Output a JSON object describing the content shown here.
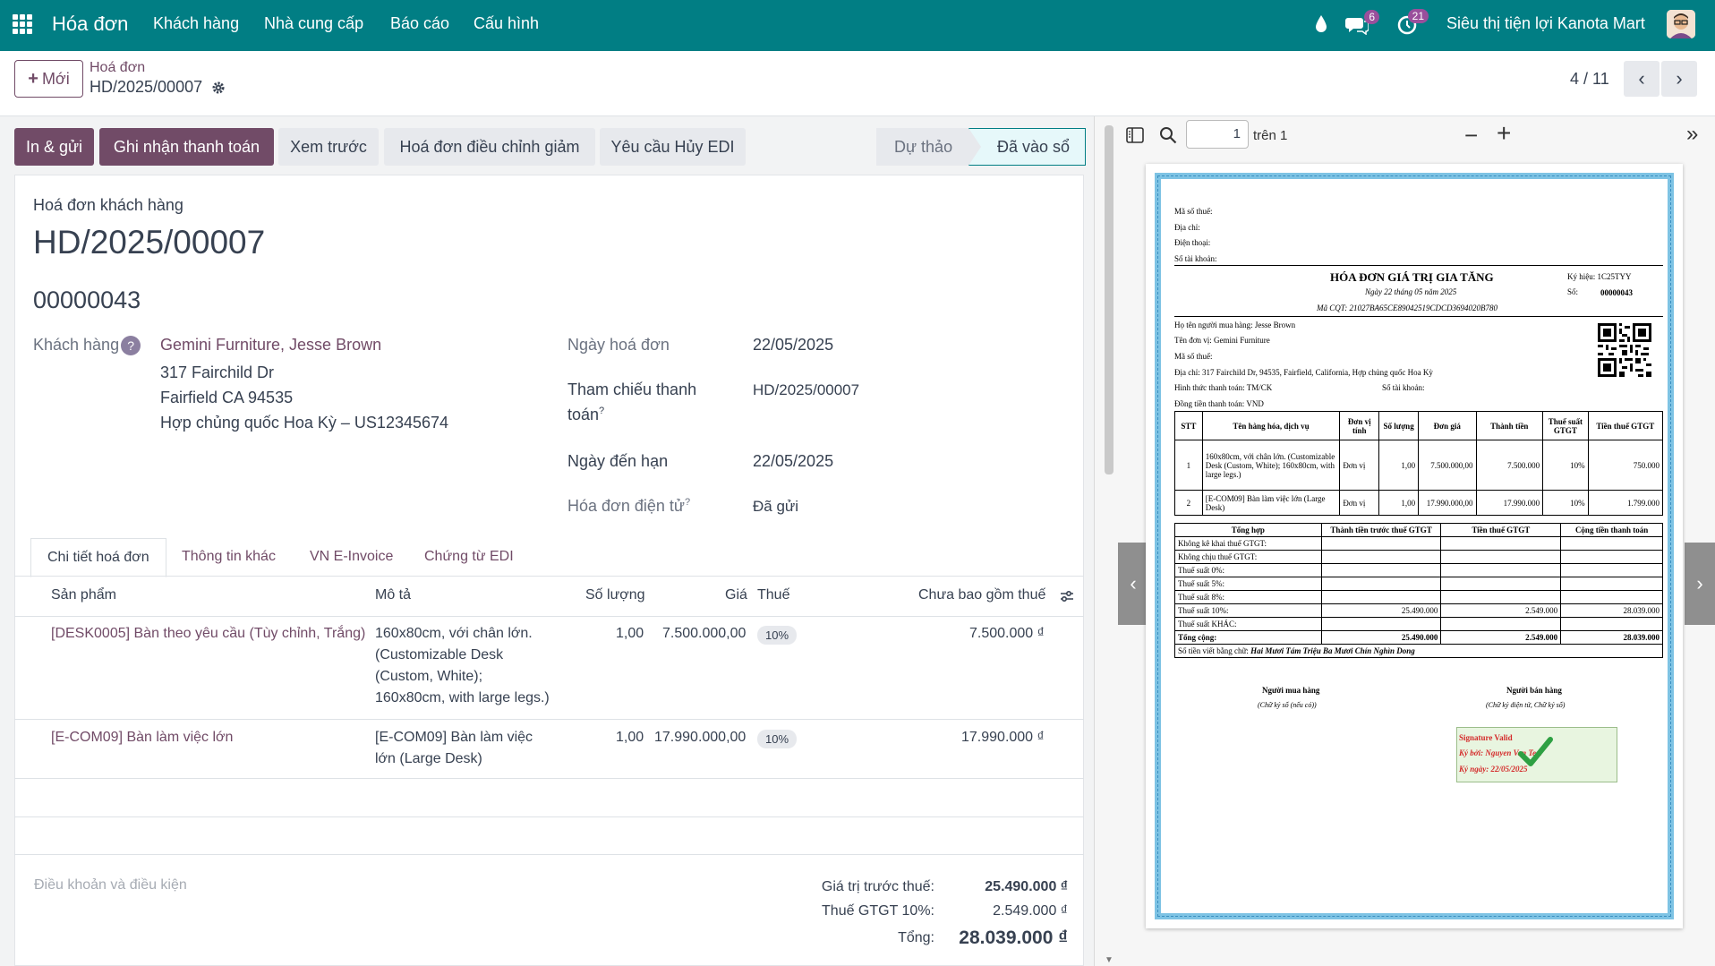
{
  "topbar": {
    "app_title": "Hóa đơn",
    "menu": [
      "Khách hàng",
      "Nhà cung cấp",
      "Báo cáo",
      "Cấu hình"
    ],
    "chat_count": "6",
    "activity_count": "21",
    "company": "Siêu thị tiện lợi Kanota Mart"
  },
  "control": {
    "new_label": "Mới",
    "breadcrumb": "Hoá đơn",
    "record_name": "HD/2025/00007",
    "pager": "4 / 11"
  },
  "actions": {
    "print_send": "In & gửi",
    "register_payment": "Ghi nhận thanh toán",
    "preview": "Xem trước",
    "credit_note": "Hoá đơn điều chỉnh giảm",
    "edi_cancel": "Yêu cầu Hủy EDI"
  },
  "statusbar": {
    "draft": "Dự thảo",
    "posted": "Đã vào sổ"
  },
  "form": {
    "move_type": "Hoá đơn khách hàng",
    "name": "HD/2025/00007",
    "sequence": "00000043",
    "customer_label": "Khách hàng",
    "customer_name": "Gemini Furniture, Jesse Brown",
    "address_1": "317 Fairchild Dr",
    "address_2": "Fairfield CA 94535",
    "address_3": "Hợp chủng quốc Hoa Kỳ – US12345674",
    "invoice_date_label": "Ngày hoá đơn",
    "invoice_date": "22/05/2025",
    "payment_ref_label_1": "Tham chiếu thanh",
    "payment_ref_label_2": "toán",
    "payment_ref": "HD/2025/00007",
    "due_date_label": "Ngày đến hạn",
    "due_date": "22/05/2025",
    "einvoice_label": "Hóa đơn điện tử",
    "einvoice_state": "Đã gửi",
    "help_mark": "?"
  },
  "tabs": [
    "Chi tiết hoá đơn",
    "Thông tin khác",
    "VN E-Invoice",
    "Chứng từ EDI"
  ],
  "lines": {
    "headers": {
      "product": "Sản phẩm",
      "description": "Mô tả",
      "quantity": "Số lượng",
      "price": "Giá",
      "tax": "Thuế",
      "subtotal": "Chưa bao gồm thuế"
    },
    "rows": [
      {
        "product": "[DESK0005] Bàn theo yêu cầu (Tùy chỉnh, Trắng)",
        "desc_1": "160x80cm, với chân lớn.",
        "desc_2": "(Customizable Desk",
        "desc_3": "(Custom, White);",
        "desc_4": "160x80cm, with large legs.)",
        "quantity": "1,00",
        "price": "7.500.000,00",
        "tax": "10%",
        "subtotal": "7.500.000 ₫"
      },
      {
        "product": "[E-COM09] Bàn làm việc lớn",
        "desc_1": "[E-COM09] Bàn làm việc",
        "desc_2": "lớn (Large Desk)",
        "quantity": "1,00",
        "price": "17.990.000,00",
        "tax": "10%",
        "subtotal": "17.990.000 ₫"
      }
    ]
  },
  "terms_placeholder": "Điều khoản và điều kiện",
  "totals": {
    "untaxed_label": "Giá trị trước thuế:",
    "untaxed": "25.490.000 ₫",
    "vat_label": "Thuế GTGT 10%:",
    "vat": "2.549.000 ₫",
    "total_label": "Tổng:",
    "total": "28.039.000 ₫"
  },
  "pdf_viewer": {
    "page": "1",
    "of_pages": "trên 1"
  },
  "pdf": {
    "seller_lines": [
      "Mã số thuế:",
      "Địa chỉ:",
      "Điện thoại:",
      "Số tài khoản:"
    ],
    "title": "HÓA ĐƠN GIÁ TRỊ GIA TĂNG",
    "date_line": "Ngày 22 tháng 05 năm 2025",
    "cqt_code": "Mã CQT: 21027BA65CE89042519CDCD3694020B780",
    "symbol_label": "Ký hiệu: 1C25TYY",
    "number_label": "Số:",
    "number": "00000043",
    "buyer_lines": [
      "Họ tên người mua hàng: Jesse Brown",
      "Tên đơn vị: Gemini Furniture",
      "Mã số thuế:",
      "Địa chỉ: 317 Fairchild Dr, 94535, Fairfield, California, Hợp chủng quốc Hoa Kỳ",
      "Hình thức thanh toán: TM/CK",
      "Đồng tiền thanh toán: VND"
    ],
    "account_label": "Số tài khoản:",
    "table_headers": [
      "STT",
      "Tên hàng hóa, dịch vụ",
      "Đơn vị tính",
      "Số lượng",
      "Đơn giá",
      "Thành tiền",
      "Thuế suất GTGT",
      "Tiền thuế GTGT"
    ],
    "rows": [
      [
        "1",
        "160x80cm, với chân lớn. (Customizable Desk (Custom, White); 160x80cm, with large legs.)",
        "Đơn vị",
        "1,00",
        "7.500.000,00",
        "7.500.000",
        "10%",
        "750.000"
      ],
      [
        "2",
        "[E-COM09] Bàn làm việc lớn (Large Desk)",
        "Đơn vị",
        "1,00",
        "17.990.000,00",
        "17.990.000",
        "10%",
        "1.799.000"
      ]
    ],
    "summary_headers": [
      "Tổng hợp",
      "Thành tiền trước thuế GTGT",
      "Tiền thuế GTGT",
      "Cộng tiền thanh toán"
    ],
    "summary_rows": [
      [
        "Không kê khai thuế GTGT:",
        "",
        "",
        ""
      ],
      [
        "Không chịu thuế GTGT:",
        "",
        "",
        ""
      ],
      [
        "Thuế suất 0%:",
        "",
        "",
        ""
      ],
      [
        "Thuế suất 5%:",
        "",
        "",
        ""
      ],
      [
        "Thuế suất 8%:",
        "",
        "",
        ""
      ],
      [
        "Thuế suất 10%:",
        "25.490.000",
        "2.549.000",
        "28.039.000"
      ],
      [
        "Thuế suất KHÁC:",
        "",
        "",
        ""
      ],
      [
        "Tổng cộng:",
        "25.490.000",
        "2.549.000",
        "28.039.000"
      ]
    ],
    "amount_words_label": "Số tiền viết bằng chữ:",
    "amount_words": "Hai Mươi Tám Triệu Ba Mươi Chín Nghìn Dong",
    "buyer_sign": "Người mua hàng",
    "buyer_sign_note": "(Chữ ký số (nếu có))",
    "seller_sign": "Người bán hàng",
    "seller_sign_note": "(Chữ ký điện tử, Chữ ký số)",
    "sig_valid": "Signature Valid",
    "sig_by_label": "Ký bởi:",
    "sig_by": "Nguyen Van Test",
    "sig_date_label": "Ký ngày:",
    "sig_date": "22/05/2025"
  }
}
